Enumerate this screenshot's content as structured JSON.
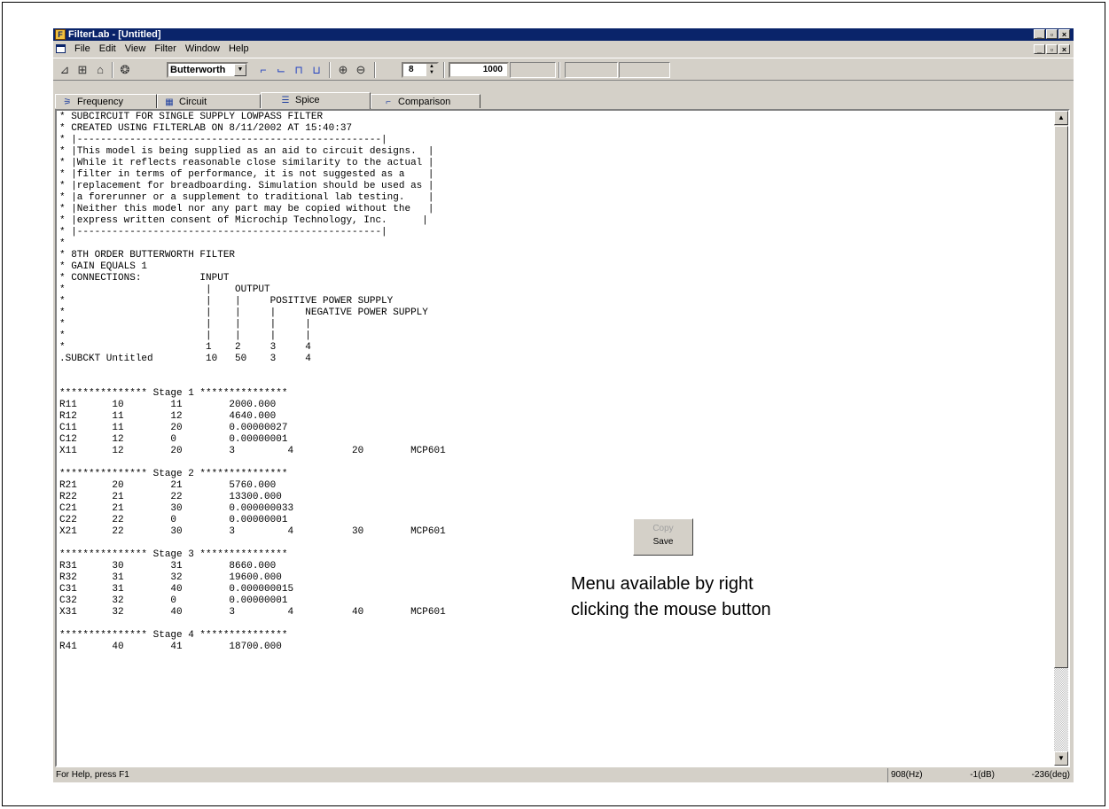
{
  "window": {
    "title": "FilterLab - [Untitled]",
    "controls": [
      "_",
      "▫",
      "×"
    ]
  },
  "menubar": {
    "items": [
      "File",
      "Edit",
      "View",
      "Filter",
      "Window",
      "Help"
    ]
  },
  "toolbar": {
    "filter_type": "Butterworth",
    "order": "8",
    "frequency": "1000"
  },
  "tabs": [
    {
      "label": "Frequency",
      "icon": "frequency-icon"
    },
    {
      "label": "Circuit",
      "icon": "circuit-icon"
    },
    {
      "label": "Spice",
      "icon": "spice-icon"
    },
    {
      "label": "Comparison",
      "icon": "comparison-icon"
    }
  ],
  "active_tab": "Spice",
  "listing": [
    "* SUBCIRCUIT FOR SINGLE SUPPLY LOWPASS FILTER",
    "* CREATED USING FILTERLAB ON 8/11/2002 AT 15:40:37",
    "* |----------------------------------------------------|",
    "* |This model is being supplied as an aid to circuit designs.  |",
    "* |While it reflects reasonable close similarity to the actual |",
    "* |filter in terms of performance, it is not suggested as a    |",
    "* |replacement for breadboarding. Simulation should be used as |",
    "* |a forerunner or a supplement to traditional lab testing.    |",
    "* |Neither this model nor any part may be copied without the   |",
    "* |express written consent of Microchip Technology, Inc.      |",
    "* |----------------------------------------------------|",
    "*",
    "* 8TH ORDER BUTTERWORTH FILTER",
    "* GAIN EQUALS 1",
    "* CONNECTIONS:          INPUT",
    "*                        |    OUTPUT",
    "*                        |    |     POSITIVE POWER SUPPLY",
    "*                        |    |     |     NEGATIVE POWER SUPPLY",
    "*                        |    |     |     |",
    "*                        |    |     |     |",
    "*                        1    2     3     4",
    ".SUBCKT Untitled         10   50    3     4",
    "",
    "",
    "*************** Stage 1 ***************",
    "R11      10        11        2000.000",
    "R12      11        12        4640.000",
    "C11      11        20        0.00000027",
    "C12      12        0         0.00000001",
    "X11      12        20        3         4          20        MCP601",
    "",
    "*************** Stage 2 ***************",
    "R21      20        21        5760.000",
    "R22      21        22        13300.000",
    "C21      21        30        0.000000033",
    "C22      22        0         0.00000001",
    "X21      22        30        3         4          30        MCP601",
    "",
    "*************** Stage 3 ***************",
    "R31      30        31        8660.000",
    "R32      31        32        19600.000",
    "C31      31        40        0.000000015",
    "C32      32        0         0.00000001",
    "X31      32        40        3         4          40        MCP601",
    "",
    "*************** Stage 4 ***************",
    "R41      40        41        18700.000"
  ],
  "context_menu": {
    "copy": "Copy",
    "save": "Save"
  },
  "annotation": "Menu available by right clicking the mouse button",
  "statusbar": {
    "help": "For Help, press F1",
    "frequency": "908(Hz)",
    "gain": "-1(dB)",
    "phase": "-236(deg)"
  }
}
